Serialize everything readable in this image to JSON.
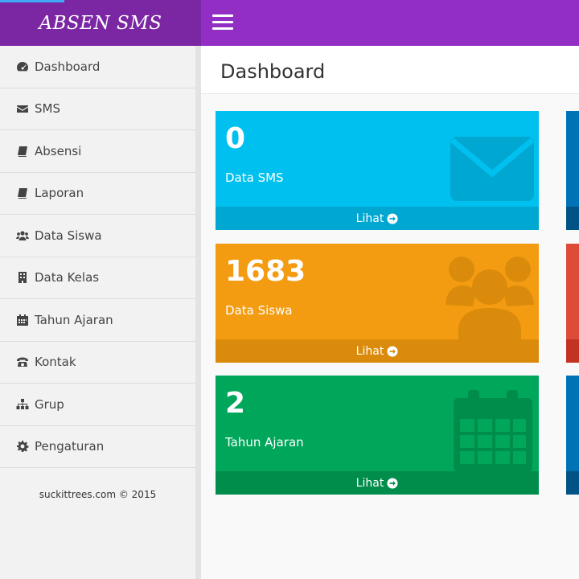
{
  "app": {
    "title": "ABSEN SMS"
  },
  "colors": {
    "topbar": "#922ec3",
    "brand": "#7b27a4",
    "aqua": "#00c0ef",
    "orange": "#f39c12",
    "green": "#00a65a",
    "blue": "#0073b7",
    "red": "#dd4b39"
  },
  "sidebar": {
    "items": [
      {
        "label": "Dashboard",
        "icon": "dashboard-icon"
      },
      {
        "label": "SMS",
        "icon": "envelope-icon"
      },
      {
        "label": "Absensi",
        "icon": "book-icon"
      },
      {
        "label": "Laporan",
        "icon": "book-icon"
      },
      {
        "label": "Data Siswa",
        "icon": "users-icon"
      },
      {
        "label": "Data Kelas",
        "icon": "building-icon"
      },
      {
        "label": "Tahun Ajaran",
        "icon": "calendar-icon"
      },
      {
        "label": "Kontak",
        "icon": "phone-icon"
      },
      {
        "label": "Grup",
        "icon": "sitemap-icon"
      },
      {
        "label": "Pengaturan",
        "icon": "gear-icon"
      }
    ],
    "footer": "suckittrees.com © 2015"
  },
  "main": {
    "title": "Dashboard",
    "cards": [
      {
        "value": "0",
        "label": "Data SMS",
        "link": "Lihat",
        "icon": "envelope-icon"
      },
      {
        "value": "1683",
        "label": "Data Siswa",
        "link": "Lihat",
        "icon": "users-icon"
      },
      {
        "value": "2",
        "label": "Tahun Ajaran",
        "link": "Lihat",
        "icon": "calendar-icon"
      }
    ]
  }
}
